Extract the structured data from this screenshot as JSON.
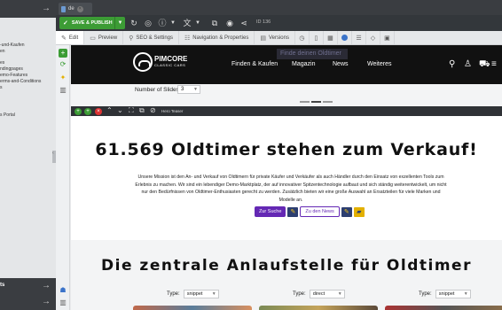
{
  "tab": {
    "label": "de"
  },
  "toolbar": {
    "save_label": "SAVE & PUBLISH",
    "id_label": "ID 136"
  },
  "edit_tabs": [
    {
      "label": "Edit",
      "icon": "pencil-icon"
    },
    {
      "label": "Preview",
      "icon": "monitor-icon"
    },
    {
      "label": "SEO & Settings",
      "icon": "search-icon"
    },
    {
      "label": "Navigation & Properties",
      "icon": "sliders-icon"
    },
    {
      "label": "Versions",
      "icon": "versions-icon"
    }
  ],
  "sidebar": {
    "tree_items": [
      "-und-Kaufen",
      "en",
      "",
      "es",
      "ndingpages",
      "emo-Features",
      "erms-and-Conditions",
      "s",
      "",
      "",
      "",
      "",
      "s Portal"
    ],
    "bottom_label": "ts"
  },
  "site": {
    "logo_main": "PIMCORE",
    "logo_sub": "CLASSIC CARS",
    "search_ghost": "Finde deinen Oldtimer",
    "nav": [
      "Finden & Kaufen",
      "Magazin",
      "News",
      "Weiteres"
    ]
  },
  "slides": {
    "label": "Number of Slides:",
    "value": "3"
  },
  "block": {
    "name": "Hero Teaser"
  },
  "hero": {
    "title": "61.569 Oldtimer stehen zum Verkauf!",
    "text": "Unsere Mission ist den An- und Verkauf von Oldtimern für private Käufer und Verkäufer als auch Händler durch den Einsatz von exzellenten Tools zum Erlebnis zu machen. Wir sind ein lebendiger Demo-Marktplatz, der auf innovativer Spitzentechnologie aufbaut und sich ständig weiterentwickelt, um nicht nur den Bedürfnissen von Oldtimer-Enthusiasten gerecht zu werden. Zusätzlich bieten wir eine große Auswahl an Ersatzteilen für viele Marken und Modelle an.",
    "button1": "Zur Suche",
    "button2": "Zu den News"
  },
  "section": {
    "title": "Die zentrale Anlaufstelle für Oldtimer"
  },
  "type_selects": [
    {
      "label": "Type:",
      "value": "snippet"
    },
    {
      "label": "Type:",
      "value": "direct"
    },
    {
      "label": "Type:",
      "value": "snippet"
    }
  ],
  "colors": {
    "save_green": "#3c9c35",
    "brand_purple": "#6428b4",
    "header_dark": "#111111"
  }
}
